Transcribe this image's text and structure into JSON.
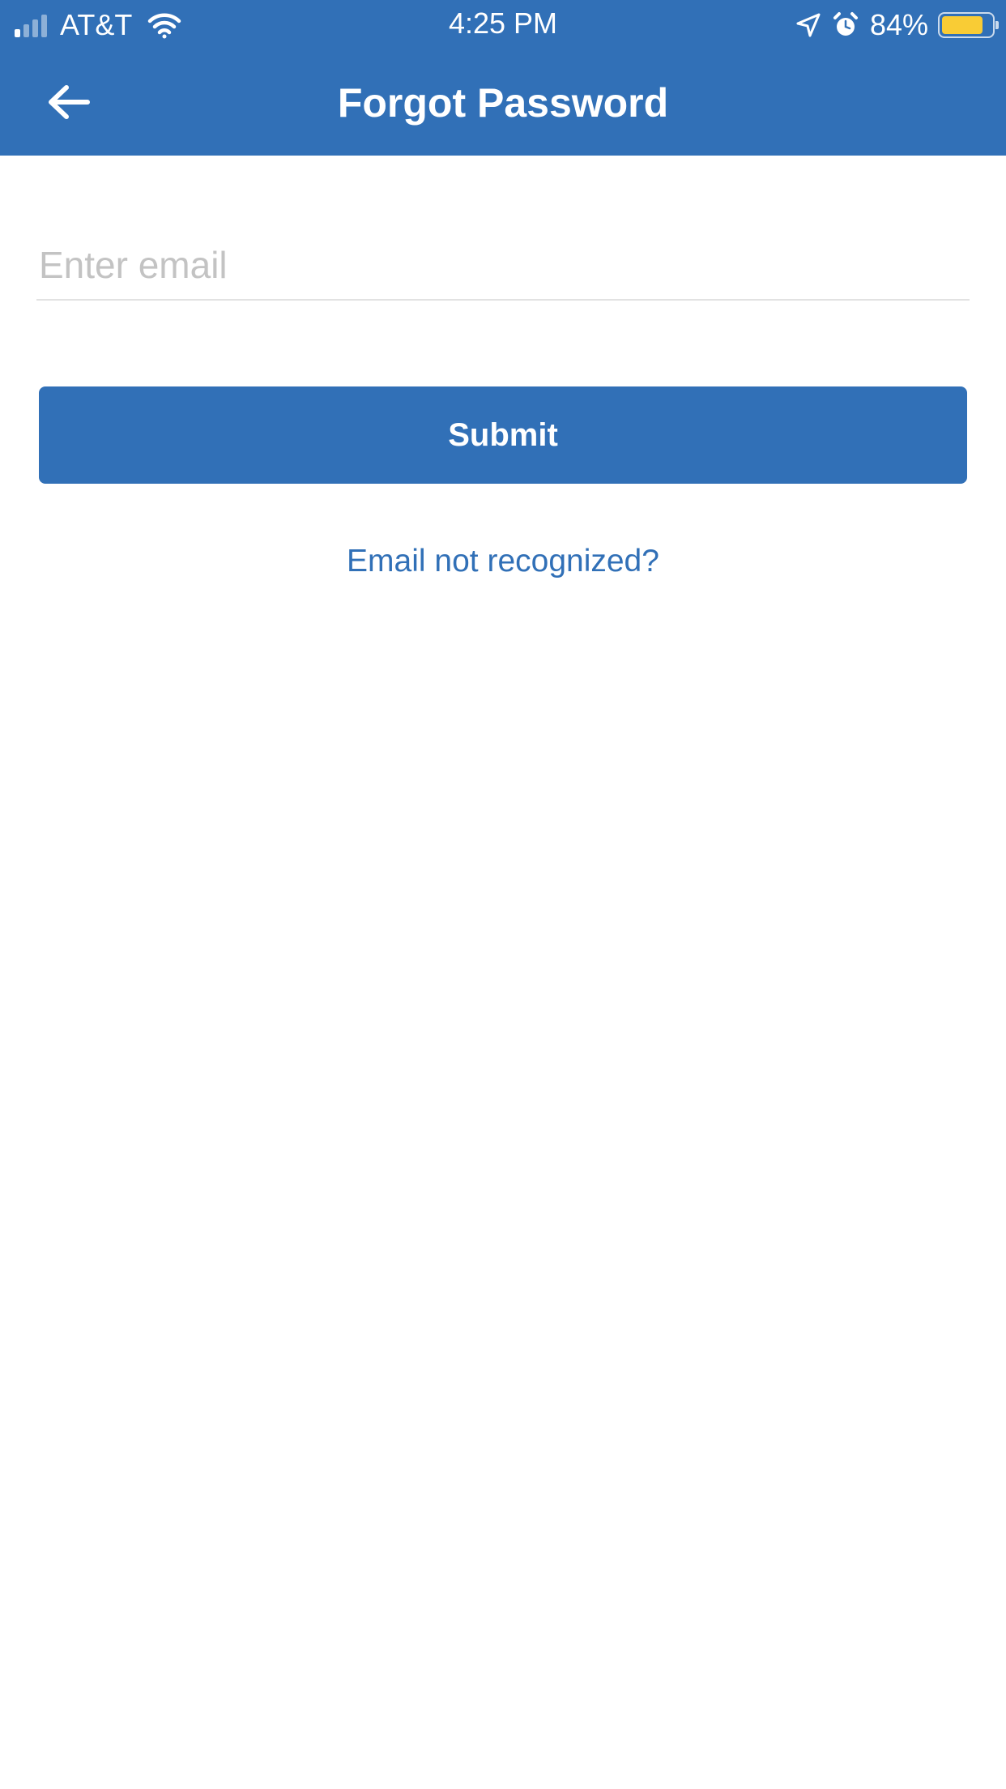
{
  "status_bar": {
    "carrier": "AT&T",
    "time": "4:25 PM",
    "battery_percent": "84%",
    "battery_level": 0.84,
    "signal_bars_active": 1,
    "signal_bars_total": 4,
    "icons": [
      "signal-icon",
      "wifi-icon",
      "location-arrow-icon",
      "alarm-icon",
      "battery-icon"
    ]
  },
  "header": {
    "title": "Forgot Password",
    "back_icon": "arrow-left-icon"
  },
  "form": {
    "email_placeholder": "Enter email",
    "email_value": "",
    "submit_label": "Submit",
    "help_link": "Email not recognized?"
  },
  "colors": {
    "primary": "#3170b7",
    "battery": "#f9cc35",
    "placeholder": "#c3c3c3",
    "divider": "#e2e2e2"
  }
}
